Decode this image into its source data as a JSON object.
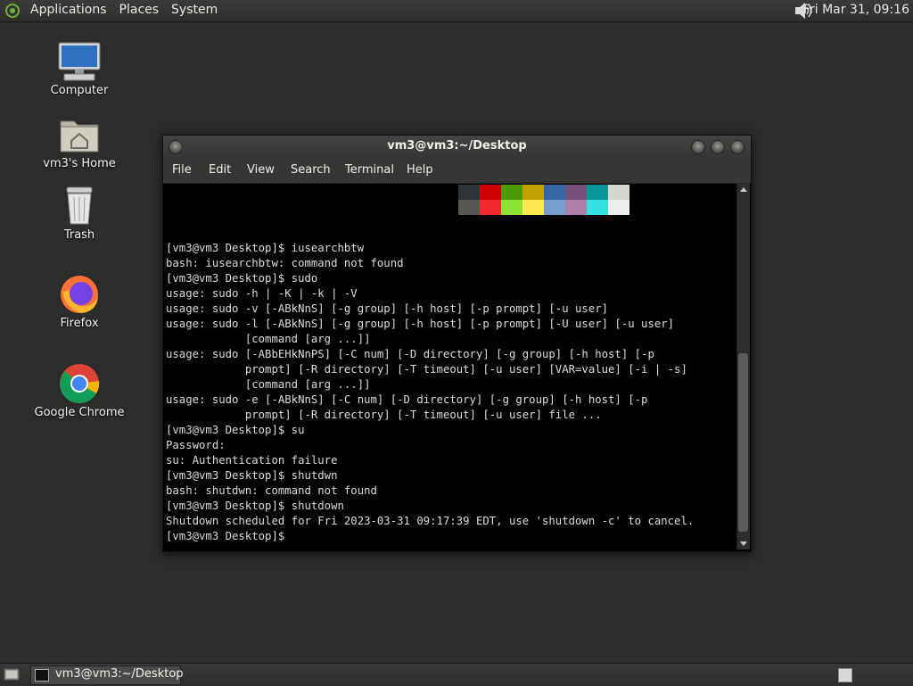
{
  "top_panel": {
    "menus": [
      "Applications",
      "Places",
      "System"
    ],
    "clock": "Fri Mar 31, 09:16"
  },
  "desktop_icons": [
    {
      "label": "Computer",
      "icon": "computer-icon"
    },
    {
      "label": "vm3's Home",
      "icon": "home-folder-icon"
    },
    {
      "label": "Trash",
      "icon": "trash-icon"
    },
    {
      "label": "Firefox",
      "icon": "firefox-icon"
    },
    {
      "label": "Google Chrome",
      "icon": "chrome-icon"
    }
  ],
  "terminal": {
    "title": "vm3@vm3:~/Desktop",
    "menus": [
      "File",
      "Edit",
      "View",
      "Search",
      "Terminal",
      "Help"
    ],
    "palette_top": [
      "#2e3436",
      "#cc0000",
      "#4e9a06",
      "#c4a000",
      "#3465a4",
      "#75507b",
      "#06989a",
      "#d3d7cf"
    ],
    "palette_bottom": [
      "#555753",
      "#ef2929",
      "#8ae234",
      "#fce94f",
      "#729fcf",
      "#ad7fa8",
      "#34e2e2",
      "#eeeeec"
    ],
    "lines": [
      "[vm3@vm3 Desktop]$ iusearchbtw",
      "bash: iusearchbtw: command not found",
      "[vm3@vm3 Desktop]$ sudo",
      "usage: sudo -h | -K | -k | -V",
      "usage: sudo -v [-ABkNnS] [-g group] [-h host] [-p prompt] [-u user]",
      "usage: sudo -l [-ABkNnS] [-g group] [-h host] [-p prompt] [-U user] [-u user]",
      "            [command [arg ...]]",
      "usage: sudo [-ABbEHkNnPS] [-C num] [-D directory] [-g group] [-h host] [-p",
      "            prompt] [-R directory] [-T timeout] [-u user] [VAR=value] [-i | -s]",
      "            [command [arg ...]]",
      "usage: sudo -e [-ABkNnS] [-C num] [-D directory] [-g group] [-h host] [-p",
      "            prompt] [-R directory] [-T timeout] [-u user] file ...",
      "[vm3@vm3 Desktop]$ su",
      "Password:",
      "su: Authentication failure",
      "[vm3@vm3 Desktop]$ shutdwn",
      "bash: shutdwn: command not found",
      "[vm3@vm3 Desktop]$ shutdown",
      "Shutdown scheduled for Fri 2023-03-31 09:17:39 EDT, use 'shutdown -c' to cancel.",
      "[vm3@vm3 Desktop]$ "
    ]
  },
  "taskbar": {
    "window_button": "vm3@vm3:~/Desktop"
  }
}
